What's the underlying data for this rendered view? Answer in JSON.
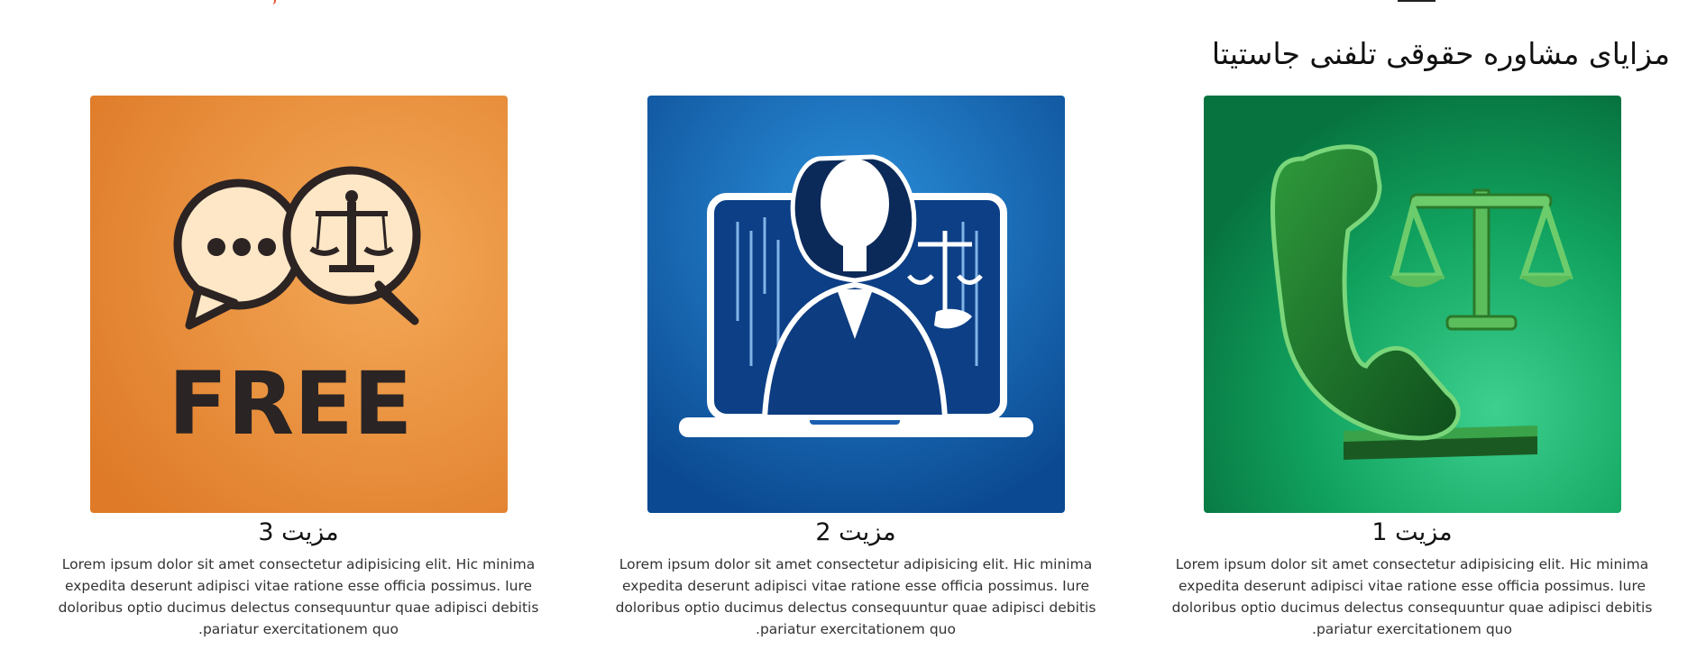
{
  "section": {
    "title": "مزایای مشاوره حقوقی تلفنی جاستیتا"
  },
  "features": [
    {
      "title": "مزیت 1",
      "text": "Lorem ipsum dolor sit amet consectetur adipisicing elit. Hic minima expedita deserunt adipisci vitae ratione esse officia possimus. Iure doloribus optio ducimus delectus consequuntur quae adipisci debitis pariatur exercitationem quo.",
      "image_icon": "phone-scales-icon",
      "image_color": "#0e8a4f"
    },
    {
      "title": "مزیت 2",
      "text": "Lorem ipsum dolor sit amet consectetur adipisicing elit. Hic minima expedita deserunt adipisci vitae ratione esse officia possimus. Iure doloribus optio ducimus delectus consequuntur quae adipisci debitis pariatur exercitationem quo.",
      "image_icon": "lawyer-laptop-icon",
      "image_color": "#1467b3"
    },
    {
      "title": "مزیت 3",
      "text": "Lorem ipsum dolor sit amet consectetur adipisicing elit. Hic minima expedita deserunt adipisci vitae ratione esse officia possimus. Iure doloribus optio ducimus delectus consequuntur quae adipisci debitis pariatur exercitationem quo.",
      "image_icon": "free-chat-scales-icon",
      "image_color": "#ec9841",
      "image_text": "FREE"
    }
  ]
}
